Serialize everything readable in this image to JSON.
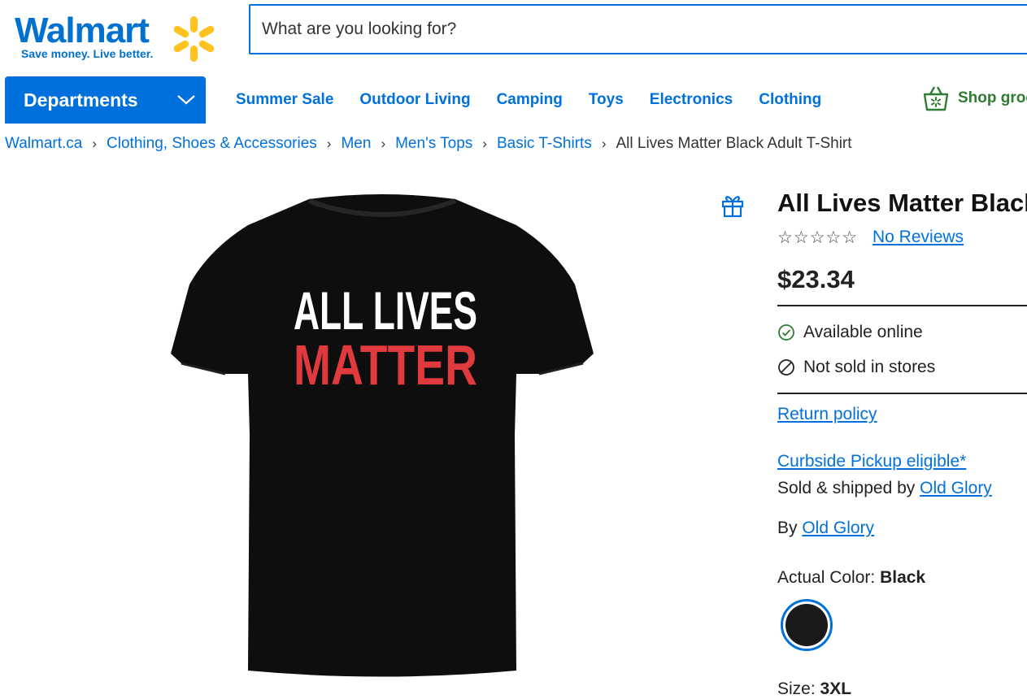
{
  "header": {
    "logo_text": "Walmart",
    "logo_tagline": "Save money. Live better.",
    "search_placeholder": "What are you looking for?",
    "departments_label": "Departments",
    "nav": [
      "Summer Sale",
      "Outdoor Living",
      "Camping",
      "Toys",
      "Electronics",
      "Clothing"
    ],
    "grocery_label": "Shop groc"
  },
  "breadcrumb": {
    "links": [
      "Walmart.ca",
      "Clothing, Shoes & Accessories",
      "Men",
      "Men's Tops",
      "Basic T-Shirts"
    ],
    "current": "All Lives Matter Black Adult T-Shirt"
  },
  "product": {
    "shirt_line1": "ALL LIVES",
    "shirt_line2": "MATTER",
    "title": "All Lives Matter Black",
    "stars": "☆☆☆☆☆",
    "reviews": "No Reviews",
    "price": "$23.34",
    "available_online": "Available online",
    "not_sold_in_stores": "Not sold in stores",
    "return_policy": "Return policy",
    "curbside": "Curbside Pickup eligible*",
    "sold_by_prefix": "Sold & shipped by ",
    "seller": "Old Glory",
    "by_prefix": "By ",
    "brand": "Old Glory",
    "color_label": "Actual Color: ",
    "color_value": "Black",
    "size_label": "Size: ",
    "size_value": "3XL"
  },
  "colors": {
    "brand_blue": "#0071dc",
    "spark_yellow": "#ffc220",
    "grocery_green": "#2e7d32",
    "available_green": "#2e7d32"
  }
}
